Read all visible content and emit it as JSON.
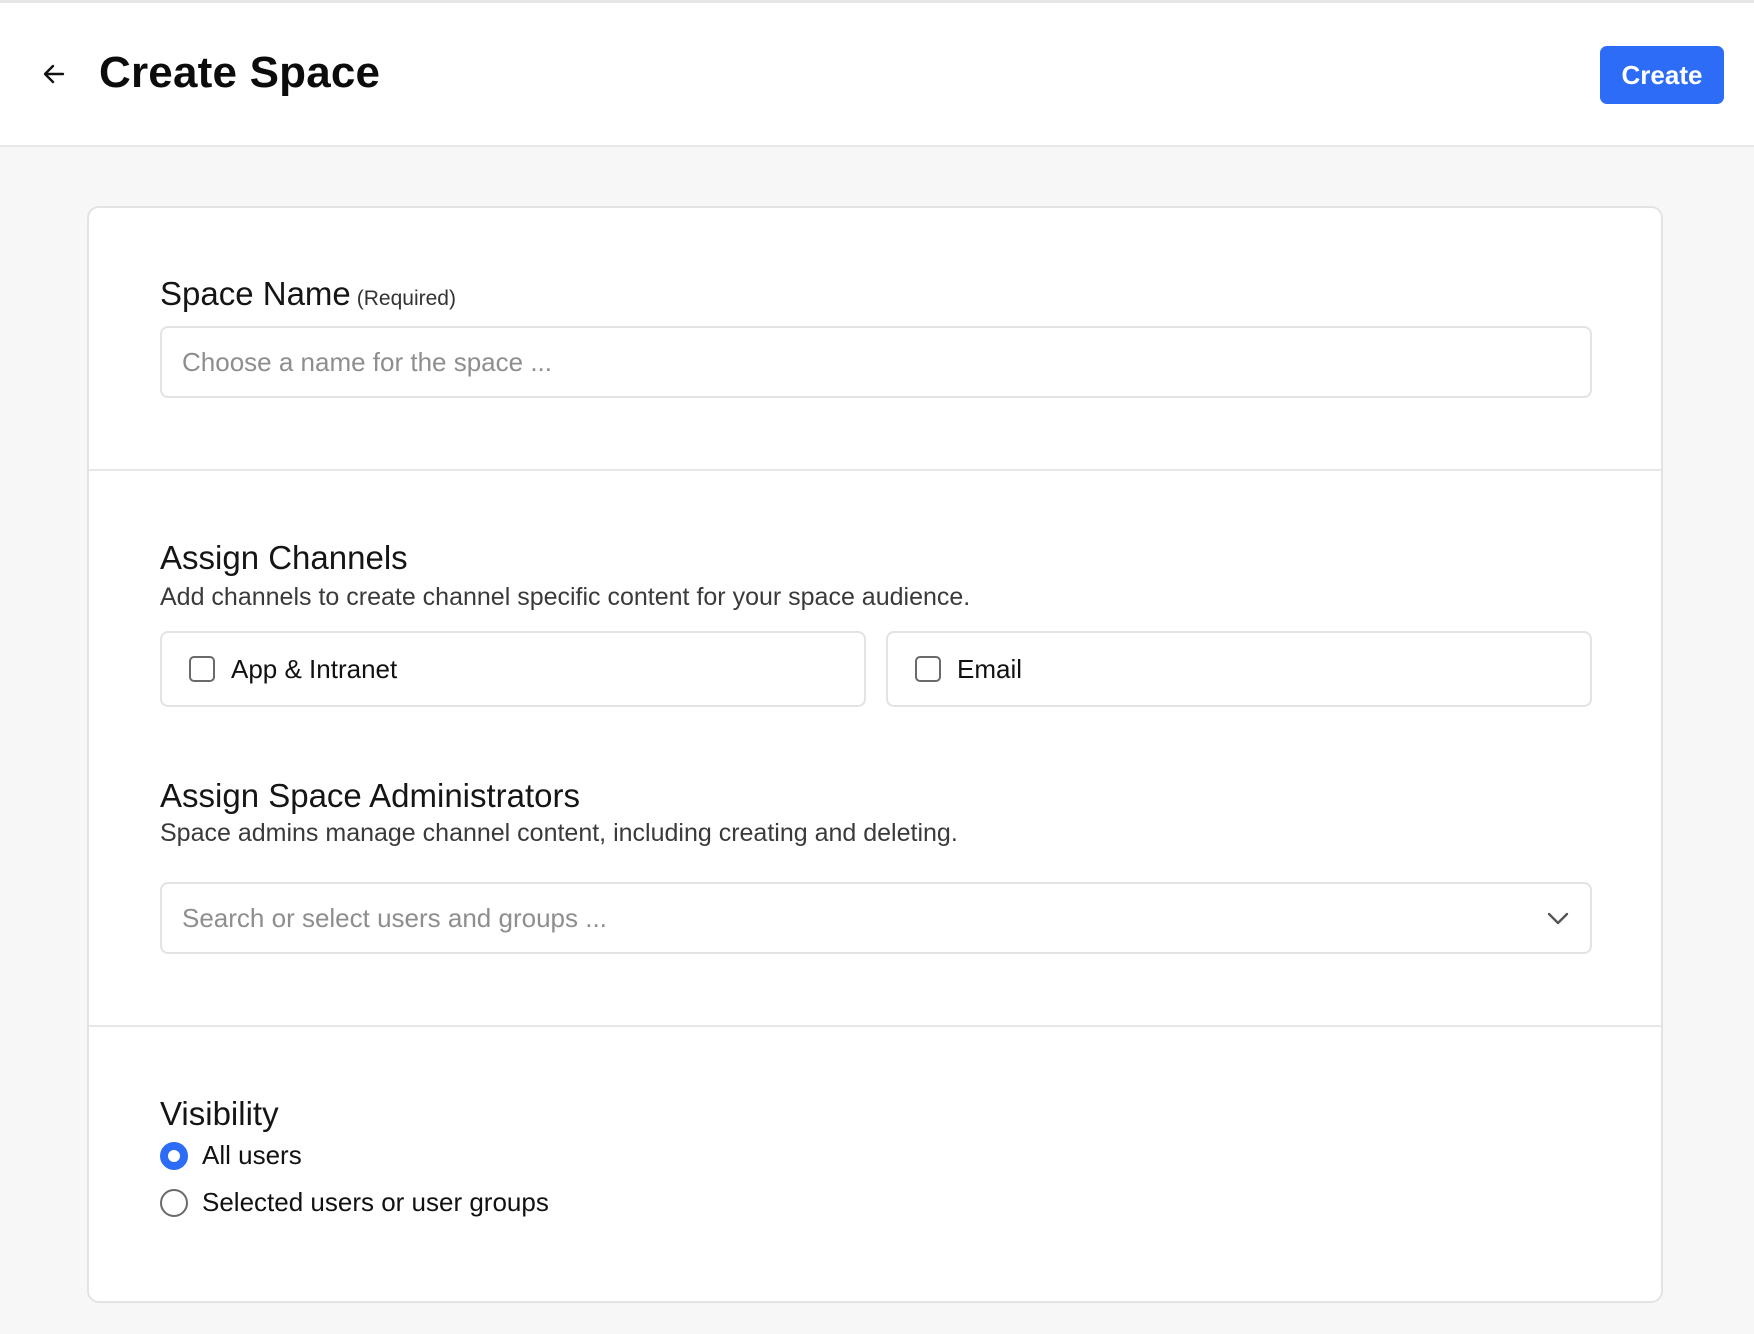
{
  "header": {
    "title": "Create Space",
    "back_icon": "arrow-left-icon",
    "create_label": "Create",
    "accent_color": "#2c6cf6"
  },
  "space_name": {
    "title": "Space Name",
    "required_label": "(Required)",
    "value": "",
    "placeholder": "Choose a name for the space ..."
  },
  "channels": {
    "title": "Assign Channels",
    "description": "Add channels to create channel specific content for your space audience.",
    "options": [
      {
        "label": "App & Intranet",
        "checked": false
      },
      {
        "label": "Email",
        "checked": false
      }
    ]
  },
  "admins": {
    "title": "Assign Space Administrators",
    "description": "Space admins manage channel content, including creating and deleting.",
    "placeholder": "Search or select users and groups ...",
    "chevron_icon": "chevron-down-icon"
  },
  "visibility": {
    "title": "Visibility",
    "options": [
      {
        "label": "All users",
        "selected": true
      },
      {
        "label": "Selected users or user groups",
        "selected": false
      }
    ]
  }
}
